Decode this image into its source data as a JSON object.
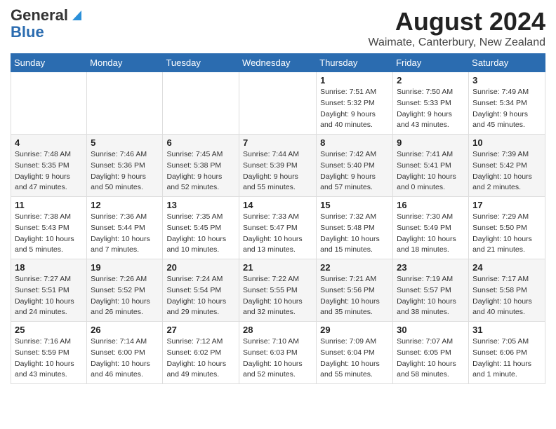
{
  "header": {
    "logo_general": "General",
    "logo_blue": "Blue",
    "month": "August 2024",
    "location": "Waimate, Canterbury, New Zealand"
  },
  "weekdays": [
    "Sunday",
    "Monday",
    "Tuesday",
    "Wednesday",
    "Thursday",
    "Friday",
    "Saturday"
  ],
  "weeks": [
    [
      {
        "day": "",
        "info": ""
      },
      {
        "day": "",
        "info": ""
      },
      {
        "day": "",
        "info": ""
      },
      {
        "day": "",
        "info": ""
      },
      {
        "day": "1",
        "info": "Sunrise: 7:51 AM\nSunset: 5:32 PM\nDaylight: 9 hours and 40 minutes."
      },
      {
        "day": "2",
        "info": "Sunrise: 7:50 AM\nSunset: 5:33 PM\nDaylight: 9 hours and 43 minutes."
      },
      {
        "day": "3",
        "info": "Sunrise: 7:49 AM\nSunset: 5:34 PM\nDaylight: 9 hours and 45 minutes."
      }
    ],
    [
      {
        "day": "4",
        "info": "Sunrise: 7:48 AM\nSunset: 5:35 PM\nDaylight: 9 hours and 47 minutes."
      },
      {
        "day": "5",
        "info": "Sunrise: 7:46 AM\nSunset: 5:36 PM\nDaylight: 9 hours and 50 minutes."
      },
      {
        "day": "6",
        "info": "Sunrise: 7:45 AM\nSunset: 5:38 PM\nDaylight: 9 hours and 52 minutes."
      },
      {
        "day": "7",
        "info": "Sunrise: 7:44 AM\nSunset: 5:39 PM\nDaylight: 9 hours and 55 minutes."
      },
      {
        "day": "8",
        "info": "Sunrise: 7:42 AM\nSunset: 5:40 PM\nDaylight: 9 hours and 57 minutes."
      },
      {
        "day": "9",
        "info": "Sunrise: 7:41 AM\nSunset: 5:41 PM\nDaylight: 10 hours and 0 minutes."
      },
      {
        "day": "10",
        "info": "Sunrise: 7:39 AM\nSunset: 5:42 PM\nDaylight: 10 hours and 2 minutes."
      }
    ],
    [
      {
        "day": "11",
        "info": "Sunrise: 7:38 AM\nSunset: 5:43 PM\nDaylight: 10 hours and 5 minutes."
      },
      {
        "day": "12",
        "info": "Sunrise: 7:36 AM\nSunset: 5:44 PM\nDaylight: 10 hours and 7 minutes."
      },
      {
        "day": "13",
        "info": "Sunrise: 7:35 AM\nSunset: 5:45 PM\nDaylight: 10 hours and 10 minutes."
      },
      {
        "day": "14",
        "info": "Sunrise: 7:33 AM\nSunset: 5:47 PM\nDaylight: 10 hours and 13 minutes."
      },
      {
        "day": "15",
        "info": "Sunrise: 7:32 AM\nSunset: 5:48 PM\nDaylight: 10 hours and 15 minutes."
      },
      {
        "day": "16",
        "info": "Sunrise: 7:30 AM\nSunset: 5:49 PM\nDaylight: 10 hours and 18 minutes."
      },
      {
        "day": "17",
        "info": "Sunrise: 7:29 AM\nSunset: 5:50 PM\nDaylight: 10 hours and 21 minutes."
      }
    ],
    [
      {
        "day": "18",
        "info": "Sunrise: 7:27 AM\nSunset: 5:51 PM\nDaylight: 10 hours and 24 minutes."
      },
      {
        "day": "19",
        "info": "Sunrise: 7:26 AM\nSunset: 5:52 PM\nDaylight: 10 hours and 26 minutes."
      },
      {
        "day": "20",
        "info": "Sunrise: 7:24 AM\nSunset: 5:54 PM\nDaylight: 10 hours and 29 minutes."
      },
      {
        "day": "21",
        "info": "Sunrise: 7:22 AM\nSunset: 5:55 PM\nDaylight: 10 hours and 32 minutes."
      },
      {
        "day": "22",
        "info": "Sunrise: 7:21 AM\nSunset: 5:56 PM\nDaylight: 10 hours and 35 minutes."
      },
      {
        "day": "23",
        "info": "Sunrise: 7:19 AM\nSunset: 5:57 PM\nDaylight: 10 hours and 38 minutes."
      },
      {
        "day": "24",
        "info": "Sunrise: 7:17 AM\nSunset: 5:58 PM\nDaylight: 10 hours and 40 minutes."
      }
    ],
    [
      {
        "day": "25",
        "info": "Sunrise: 7:16 AM\nSunset: 5:59 PM\nDaylight: 10 hours and 43 minutes."
      },
      {
        "day": "26",
        "info": "Sunrise: 7:14 AM\nSunset: 6:00 PM\nDaylight: 10 hours and 46 minutes."
      },
      {
        "day": "27",
        "info": "Sunrise: 7:12 AM\nSunset: 6:02 PM\nDaylight: 10 hours and 49 minutes."
      },
      {
        "day": "28",
        "info": "Sunrise: 7:10 AM\nSunset: 6:03 PM\nDaylight: 10 hours and 52 minutes."
      },
      {
        "day": "29",
        "info": "Sunrise: 7:09 AM\nSunset: 6:04 PM\nDaylight: 10 hours and 55 minutes."
      },
      {
        "day": "30",
        "info": "Sunrise: 7:07 AM\nSunset: 6:05 PM\nDaylight: 10 hours and 58 minutes."
      },
      {
        "day": "31",
        "info": "Sunrise: 7:05 AM\nSunset: 6:06 PM\nDaylight: 11 hours and 1 minute."
      }
    ]
  ]
}
